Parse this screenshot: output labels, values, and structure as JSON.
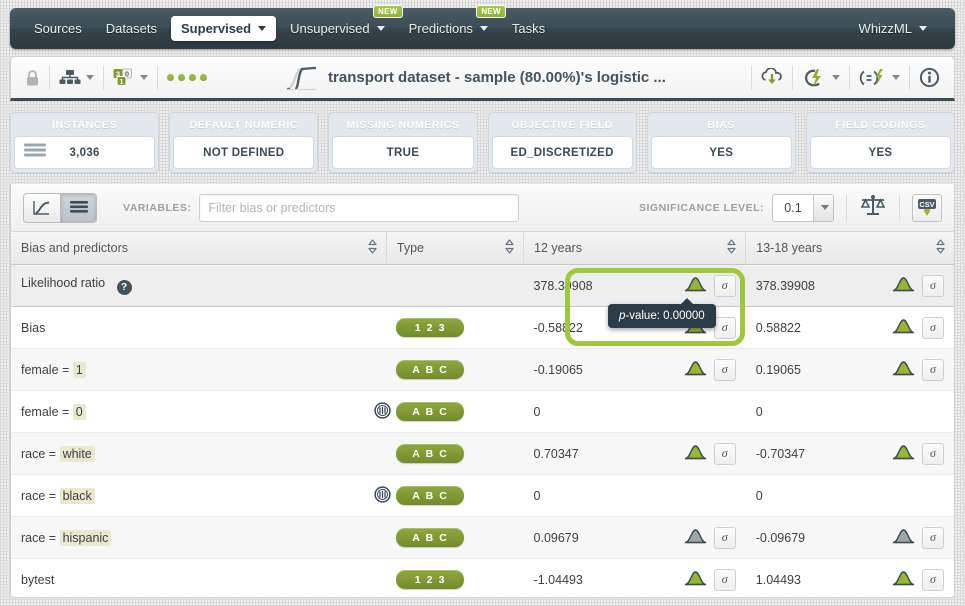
{
  "nav": {
    "items": [
      {
        "label": "Sources",
        "caret": false,
        "active": false,
        "badge": null
      },
      {
        "label": "Datasets",
        "caret": false,
        "active": false,
        "badge": null
      },
      {
        "label": "Supervised",
        "caret": true,
        "active": true,
        "badge": null
      },
      {
        "label": "Unsupervised",
        "caret": true,
        "active": false,
        "badge": "NEW"
      },
      {
        "label": "Predictions",
        "caret": true,
        "active": false,
        "badge": "NEW"
      },
      {
        "label": "Tasks",
        "caret": false,
        "active": false,
        "badge": null
      }
    ],
    "account": {
      "label": "WhizzML",
      "caret": true
    }
  },
  "toolbar": {
    "lock_icon": "lock-icon",
    "share_icon": "network-share-icon",
    "fields_icon": "field-types-icon",
    "status_dots": 4,
    "model_icon": "logistic-curve-icon",
    "title": "transport dataset - sample (80.00%)'s logistic ...",
    "right_actions": [
      {
        "name": "download-icon",
        "caret": false
      },
      {
        "name": "actions-lightning-icon",
        "caret": true
      },
      {
        "name": "batch-prediction-icon",
        "caret": true
      },
      {
        "name": "info-icon",
        "caret": false
      }
    ]
  },
  "cards": [
    {
      "title": "INSTANCES",
      "value": "3,036",
      "icon": "instances-icon"
    },
    {
      "title": "DEFAULT NUMERIC",
      "value": "NOT DEFINED",
      "icon": null
    },
    {
      "title": "MISSING NUMERICS",
      "value": "TRUE",
      "icon": null
    },
    {
      "title": "OBJECTIVE FIELD",
      "value": "ED_DISCRETIZED",
      "icon": null
    },
    {
      "title": "BIAS",
      "value": "YES",
      "icon": null
    },
    {
      "title": "FIELD CODINGS",
      "value": "YES",
      "icon": null
    }
  ],
  "controls": {
    "view_chart_label": "chart-view-icon",
    "view_table_label": "table-view-icon",
    "active_view": "table",
    "variables_label": "VARIABLES:",
    "filter_value": "",
    "filter_placeholder": "Filter bias or predictors",
    "significance_label": "SIGNIFICANCE LEVEL:",
    "significance_value": "0.1",
    "compare_icon": "scales-compare-icon",
    "export_icon": "csv-download-icon",
    "export_label": "CSV"
  },
  "table": {
    "columns": [
      {
        "label": "Bias and predictors",
        "sortable": true
      },
      {
        "label": "Type",
        "sortable": true
      },
      {
        "label": "12 years",
        "sortable": true
      },
      {
        "label": "13-18 years",
        "sortable": true
      }
    ],
    "rows": [
      {
        "name": "Likelihood ratio",
        "help": "?",
        "is_header_row": true,
        "reference": false,
        "type": null,
        "c1": {
          "value": "378.39908",
          "sig": true,
          "sigma": "σ"
        },
        "c2": {
          "value": "378.39908",
          "sig": true,
          "sigma": "σ"
        }
      },
      {
        "name": "Bias",
        "prefix": null,
        "highlight": null,
        "reference": false,
        "type": "1 2 3",
        "c1": {
          "value": "-0.58822",
          "sig": true,
          "sigma": "σ"
        },
        "c2": {
          "value": "0.58822",
          "sig": true,
          "sigma": "σ"
        }
      },
      {
        "name": null,
        "prefix": "female = ",
        "highlight": "1",
        "reference": false,
        "type": "A B C",
        "c1": {
          "value": "-0.19065",
          "sig": true,
          "sigma": "σ"
        },
        "c2": {
          "value": "0.19065",
          "sig": true,
          "sigma": "σ"
        }
      },
      {
        "name": null,
        "prefix": "female = ",
        "highlight": "0",
        "reference": true,
        "type": "A B C",
        "c1": {
          "value": "0",
          "sig": null,
          "sigma": null
        },
        "c2": {
          "value": "0",
          "sig": null,
          "sigma": null
        }
      },
      {
        "name": null,
        "prefix": "race = ",
        "highlight": "white",
        "reference": false,
        "type": "A B C",
        "c1": {
          "value": "0.70347",
          "sig": true,
          "sigma": "σ"
        },
        "c2": {
          "value": "-0.70347",
          "sig": true,
          "sigma": "σ"
        }
      },
      {
        "name": null,
        "prefix": "race = ",
        "highlight": "black",
        "reference": true,
        "type": "A B C",
        "c1": {
          "value": "0",
          "sig": null,
          "sigma": null
        },
        "c2": {
          "value": "0",
          "sig": null,
          "sigma": null
        }
      },
      {
        "name": null,
        "prefix": "race = ",
        "highlight": "hispanic",
        "reference": false,
        "type": "A B C",
        "c1": {
          "value": "0.09679",
          "sig": false,
          "sigma": "σ"
        },
        "c2": {
          "value": "-0.09679",
          "sig": false,
          "sigma": "σ"
        }
      },
      {
        "name": "bytest",
        "prefix": null,
        "highlight": null,
        "reference": false,
        "type": "1 2 3",
        "c1": {
          "value": "-1.04493",
          "sig": true,
          "sigma": "σ"
        },
        "c2": {
          "value": "1.04493",
          "sig": true,
          "sigma": "σ"
        }
      }
    ]
  },
  "tooltip": {
    "prefix": "p",
    "text": "-value: 0.00000"
  },
  "colors": {
    "accent_green": "#8fa83e",
    "highlight_border": "#9fc73f",
    "nav_dark": "#3d4a52",
    "tooltip_bg": "#2c3b48",
    "value_highlight": "#e8e9cf"
  }
}
